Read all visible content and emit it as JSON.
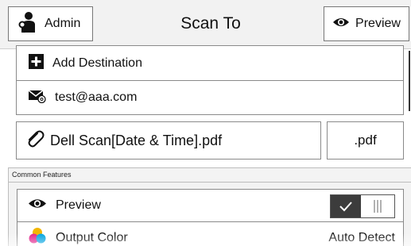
{
  "header": {
    "admin_label": "Admin",
    "title": "Scan To",
    "preview_label": "Preview"
  },
  "destinations": {
    "add_label": "Add Destination",
    "email": "test@aaa.com"
  },
  "file": {
    "name": "Dell Scan[Date & Time].pdf",
    "extension": ".pdf"
  },
  "features": {
    "heading": "Common Features",
    "preview_label": "Preview",
    "preview_enabled": true,
    "output_color_label": "Output Color",
    "output_color_value": "Auto Detect"
  },
  "icons": {
    "admin": "admin-user-icon",
    "preview": "eye-icon",
    "add": "plus-icon",
    "email": "email-icon",
    "attachment": "paperclip-icon",
    "output_color": "color-circles-icon"
  },
  "colors": {
    "toggle_on": "#3c3c3c",
    "header_bg": "#f2f2f2",
    "section_bg": "#f3f3f3"
  }
}
